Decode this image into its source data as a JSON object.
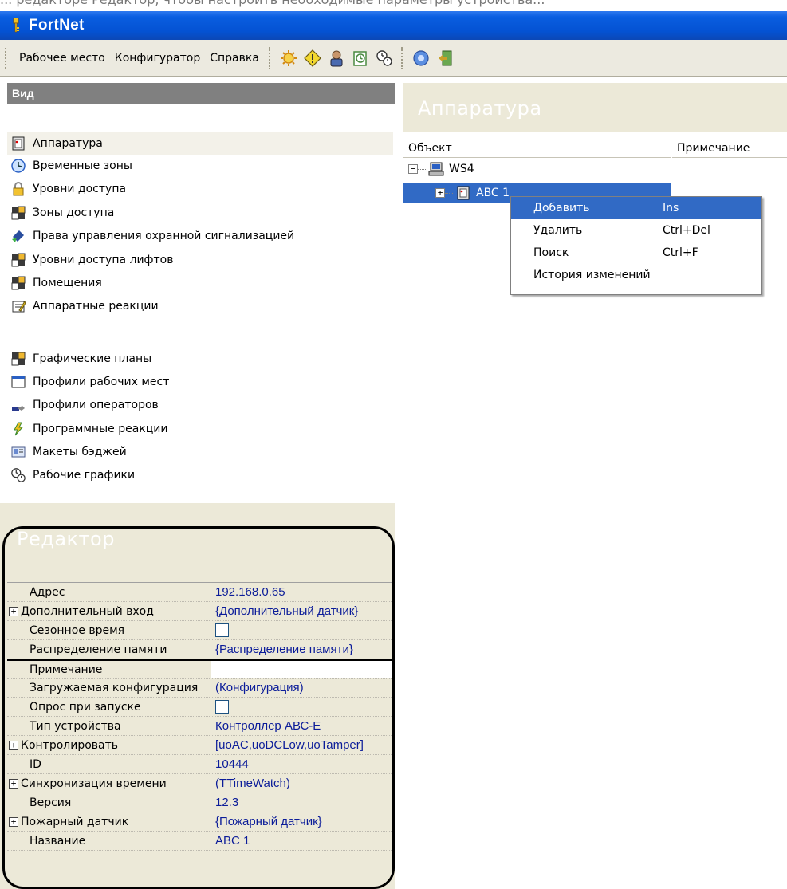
{
  "caption": {
    "text": "... редакторе Редактор, чтобы настроить необходимые параметры устройства..."
  },
  "window": {
    "title": "FortNet"
  },
  "menu": {
    "items": [
      "Рабочее место",
      "Конфигуратор",
      "Справка"
    ]
  },
  "toolbar": {
    "buttons": [
      {
        "icon": "gear-sun-icon",
        "color": "#e0a020"
      },
      {
        "icon": "diamond-warning-icon",
        "color": "#d8c020"
      },
      {
        "icon": "person-icon",
        "color": "#6b4a2b"
      },
      {
        "icon": "clock-doc-icon",
        "color": "#4a8a40"
      },
      {
        "icon": "schedule-icon",
        "color": "#404040"
      },
      {
        "icon": "help-icon",
        "color": "#3a6bc4"
      },
      {
        "icon": "exit-door-icon",
        "color": "#4a8a40"
      }
    ]
  },
  "view_panel": {
    "header": "Вид",
    "items": [
      {
        "label": "Аппаратура",
        "icon": "hardware-icon",
        "selected": true
      },
      {
        "label": "Временные зоны",
        "icon": "clock-icon"
      },
      {
        "label": "Уровни доступа",
        "icon": "lock-icon"
      },
      {
        "label": "Зоны доступа",
        "icon": "zones-icon"
      },
      {
        "label": "Права управления охранной сигнализацией",
        "icon": "alarm-rights-icon"
      },
      {
        "label": "Уровни доступа лифтов",
        "icon": "zones-icon"
      },
      {
        "label": "Помещения",
        "icon": "zones-icon"
      },
      {
        "label": "Аппаратные реакции",
        "icon": "reactions-icon"
      },
      {
        "label": "Графические планы",
        "icon": "zones-icon"
      },
      {
        "label": "Профили рабочих мест",
        "icon": "window-icon"
      },
      {
        "label": "Профили операторов",
        "icon": "operator-icon"
      },
      {
        "label": "Программные реакции",
        "icon": "lightning-icon"
      },
      {
        "label": "Макеты бэджей",
        "icon": "badge-icon"
      },
      {
        "label": "Рабочие графики",
        "icon": "schedule-icon"
      }
    ]
  },
  "editor": {
    "header": "Редактор",
    "properties": [
      {
        "name": "Адрес",
        "value": "192.168.0.65"
      },
      {
        "name": "Дополнительный вход",
        "value": "{Дополнительный датчик}",
        "expandable": true
      },
      {
        "name": "Сезонное время",
        "checkbox": true
      },
      {
        "name": "Распределение памяти",
        "value": "{Распределение памяти}"
      },
      {
        "name": "Примечание",
        "value": "",
        "white": true
      },
      {
        "name": "Загружаемая конфигурация",
        "value": "(Конфигурация)"
      },
      {
        "name": "Опрос при запуске",
        "checkbox": true
      },
      {
        "name": "Тип устройства",
        "value": "Контроллер АВС-Е"
      },
      {
        "name": "Контролировать",
        "value": "[uoAC,uoDCLow,uoTamper]",
        "expandable": true
      },
      {
        "name": "ID",
        "value": "10444"
      },
      {
        "name": "Синхронизация времени",
        "value": "(TTimeWatch)",
        "expandable": true
      },
      {
        "name": "Версия",
        "value": "12.3"
      },
      {
        "name": "Пожарный датчик",
        "value": "{Пожарный датчик}",
        "expandable": true
      },
      {
        "name": "Название",
        "value": "ABC 1"
      }
    ]
  },
  "hardware_panel": {
    "header": "Аппаратура",
    "columns": [
      "Объект",
      "Примечание"
    ],
    "tree": [
      {
        "label": "WS4",
        "icon": "computer-icon",
        "expander": "−",
        "level": 0
      },
      {
        "label": "ABC 1",
        "icon": "hardware-icon",
        "expander": "+",
        "level": 1,
        "selected": true
      }
    ]
  },
  "context_menu": {
    "items": [
      {
        "label": "Добавить",
        "shortcut": "Ins",
        "active": true
      },
      {
        "label": "Удалить",
        "shortcut": "Ctrl+Del"
      },
      {
        "label": "Поиск",
        "shortcut": "Ctrl+F"
      },
      {
        "label": "История изменений",
        "shortcut": ""
      }
    ]
  },
  "colors": {
    "titlebar": "#0452d3",
    "selection": "#316ac5",
    "panel": "#ece9d8",
    "view_header": "#808080"
  }
}
